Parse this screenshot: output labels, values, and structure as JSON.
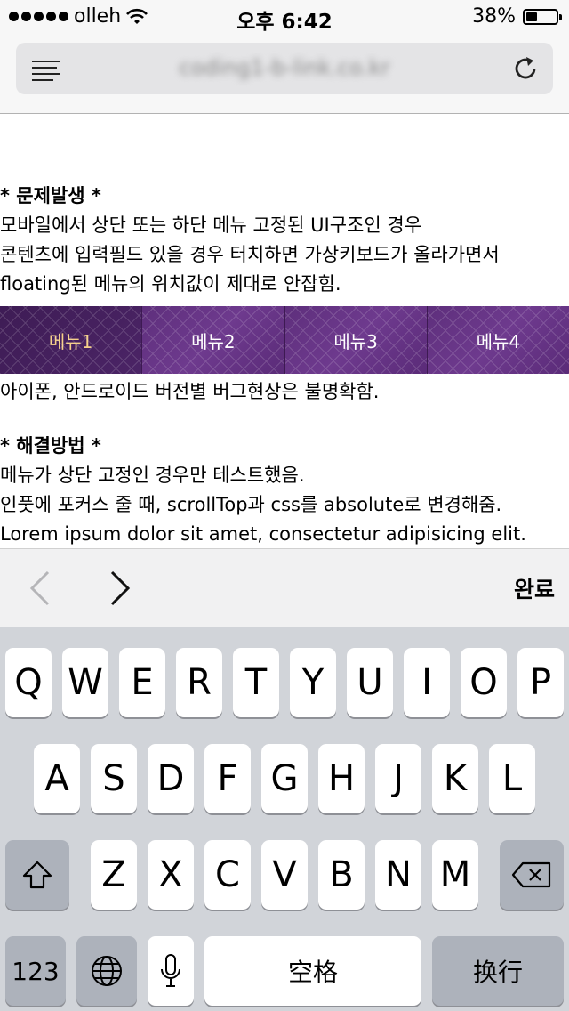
{
  "status_bar": {
    "carrier": "olleh",
    "time": "오후 6:42",
    "battery_percent": "38%",
    "battery_level": 0.38
  },
  "address_bar": {
    "url": "coding1-b-link.co.kr",
    "menu_icon": "hamburger-icon",
    "reload_icon": "reload-icon"
  },
  "content": {
    "problem_heading": "* 문제발생 *",
    "problem_lines": [
      "모바일에서 상단 또는 하단 메뉴 고정된 UI구조인 경우",
      "콘텐츠에 입력필드 있을 경우 터치하면 가상키보드가 올라가면서",
      "floating된 메뉴의 위치값이 제대로 안잡힘."
    ],
    "bug_line": "아이폰, 안드로이드 버전별 버그현상은 불명확함.",
    "solution_heading": "* 해결방법 *",
    "solution_lines": [
      "메뉴가 상단 고정인 경우만 테스트했음.",
      "인풋에 포커스 줄 때, scrollTop과 css를 absolute로 변경해줌.",
      "Lorem ipsum dolor sit amet, consectetur adipisicing elit."
    ]
  },
  "menu": {
    "items": [
      "메뉴1",
      "메뉴2",
      "메뉴3",
      "메뉴4"
    ],
    "active_color": "#f5d08a",
    "bg_color": "#5e2f7c"
  },
  "accessory": {
    "done_label": "완료",
    "prev_icon": "chevron-left-icon",
    "next_icon": "chevron-right-icon"
  },
  "keyboard": {
    "row1": [
      "Q",
      "W",
      "E",
      "R",
      "T",
      "Y",
      "U",
      "I",
      "O",
      "P"
    ],
    "row2": [
      "A",
      "S",
      "D",
      "F",
      "G",
      "H",
      "J",
      "K",
      "L"
    ],
    "row3": [
      "Z",
      "X",
      "C",
      "V",
      "B",
      "N",
      "M"
    ],
    "numbers_label": "123",
    "space_label": "空格",
    "return_label": "换行",
    "shift_icon": "shift-icon",
    "delete_icon": "delete-icon",
    "globe_icon": "globe-icon",
    "mic_icon": "microphone-icon"
  }
}
